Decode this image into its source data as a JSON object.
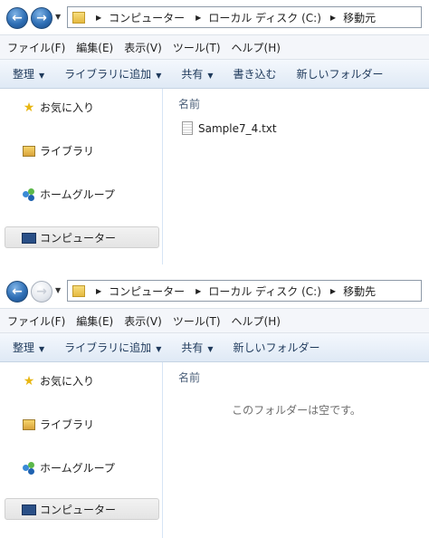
{
  "window1": {
    "breadcrumb": [
      "コンピューター",
      "ローカル ディスク (C:)",
      "移動元"
    ],
    "menu": [
      "ファイル(F)",
      "編集(E)",
      "表示(V)",
      "ツール(T)",
      "ヘルプ(H)"
    ],
    "commands": [
      "整理",
      "ライブラリに追加",
      "共有",
      "書き込む",
      "新しいフォルダー"
    ],
    "nav": [
      "お気に入り",
      "ライブラリ",
      "ホームグループ",
      "コンピューター"
    ],
    "column_header": "名前",
    "file": "Sample7_4.txt"
  },
  "window2": {
    "breadcrumb": [
      "コンピューター",
      "ローカル ディスク (C:)",
      "移動先"
    ],
    "menu": [
      "ファイル(F)",
      "編集(E)",
      "表示(V)",
      "ツール(T)",
      "ヘルプ(H)"
    ],
    "commands": [
      "整理",
      "ライブラリに追加",
      "共有",
      "新しいフォルダー"
    ],
    "nav": [
      "お気に入り",
      "ライブラリ",
      "ホームグループ",
      "コンピューター"
    ],
    "column_header": "名前",
    "empty_message": "このフォルダーは空です。"
  },
  "icons": {
    "back": "back-arrow-icon",
    "forward": "forward-arrow-icon",
    "folder": "folder-icon",
    "favorites": "star-icon",
    "library": "library-icon",
    "homegroup": "homegroup-icon",
    "computer": "computer-icon",
    "text_file": "text-file-icon"
  }
}
